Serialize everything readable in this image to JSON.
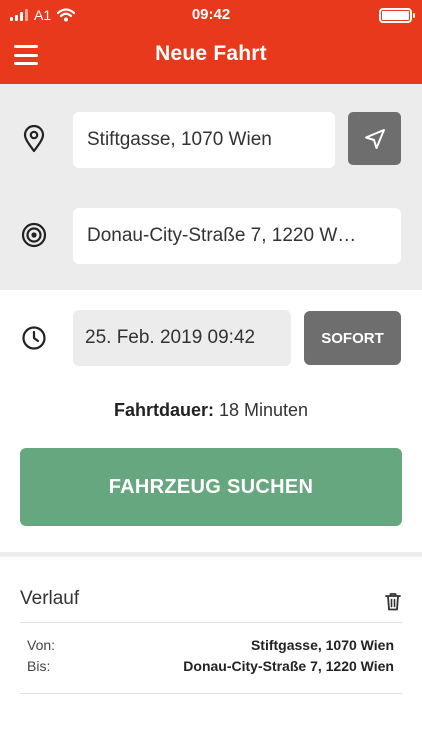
{
  "status_bar": {
    "carrier": "A1",
    "time": "09:42",
    "icons": [
      "signal-icon",
      "wifi-icon",
      "battery-icon"
    ]
  },
  "navbar": {
    "title": "Neue Fahrt",
    "menu_icon": "menu-icon"
  },
  "route": {
    "origin": {
      "value": "Stiftgasse, 1070 Wien",
      "icon": "location-pin-icon"
    },
    "destination": {
      "value": "Donau-City-Straße 7, 1220 W…",
      "icon": "target-icon"
    },
    "locate_button_icon": "navigation-arrow-icon"
  },
  "schedule": {
    "datetime": "25. Feb. 2019 09:42",
    "now_button": "SOFORT",
    "icon": "clock-icon"
  },
  "duration": {
    "label": "Fahrtdauer:",
    "value": "18 Minuten"
  },
  "search_button": "FAHRZEUG SUCHEN",
  "history": {
    "title": "Verlauf",
    "delete_icon": "trash-icon",
    "items": [
      {
        "from_label": "Von:",
        "from": "Stiftgasse, 1070 Wien",
        "to_label": "Bis:",
        "to": "Donau-City-Straße 7, 1220 Wien"
      }
    ]
  },
  "colors": {
    "brand": "#e8391c",
    "panel": "#ececec",
    "button_dark": "#6e6e6e",
    "primary_action": "#67a77f"
  }
}
